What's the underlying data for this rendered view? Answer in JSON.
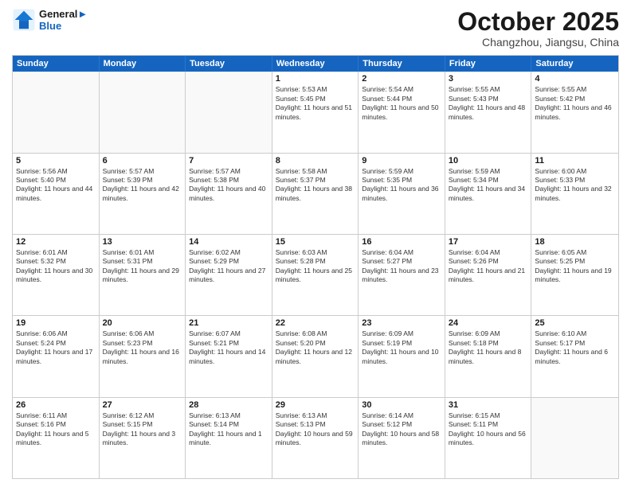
{
  "header": {
    "logo": {
      "line1": "General",
      "line2": "Blue"
    },
    "month": "October 2025",
    "location": "Changzhou, Jiangsu, China"
  },
  "weekdays": [
    "Sunday",
    "Monday",
    "Tuesday",
    "Wednesday",
    "Thursday",
    "Friday",
    "Saturday"
  ],
  "rows": [
    [
      {
        "day": "",
        "empty": true
      },
      {
        "day": "",
        "empty": true
      },
      {
        "day": "",
        "empty": true
      },
      {
        "day": "1",
        "rise": "5:53 AM",
        "set": "5:45 PM",
        "daylight": "11 hours and 51 minutes."
      },
      {
        "day": "2",
        "rise": "5:54 AM",
        "set": "5:44 PM",
        "daylight": "11 hours and 50 minutes."
      },
      {
        "day": "3",
        "rise": "5:55 AM",
        "set": "5:43 PM",
        "daylight": "11 hours and 48 minutes."
      },
      {
        "day": "4",
        "rise": "5:55 AM",
        "set": "5:42 PM",
        "daylight": "11 hours and 46 minutes."
      }
    ],
    [
      {
        "day": "5",
        "rise": "5:56 AM",
        "set": "5:40 PM",
        "daylight": "11 hours and 44 minutes."
      },
      {
        "day": "6",
        "rise": "5:57 AM",
        "set": "5:39 PM",
        "daylight": "11 hours and 42 minutes."
      },
      {
        "day": "7",
        "rise": "5:57 AM",
        "set": "5:38 PM",
        "daylight": "11 hours and 40 minutes."
      },
      {
        "day": "8",
        "rise": "5:58 AM",
        "set": "5:37 PM",
        "daylight": "11 hours and 38 minutes."
      },
      {
        "day": "9",
        "rise": "5:59 AM",
        "set": "5:35 PM",
        "daylight": "11 hours and 36 minutes."
      },
      {
        "day": "10",
        "rise": "5:59 AM",
        "set": "5:34 PM",
        "daylight": "11 hours and 34 minutes."
      },
      {
        "day": "11",
        "rise": "6:00 AM",
        "set": "5:33 PM",
        "daylight": "11 hours and 32 minutes."
      }
    ],
    [
      {
        "day": "12",
        "rise": "6:01 AM",
        "set": "5:32 PM",
        "daylight": "11 hours and 30 minutes."
      },
      {
        "day": "13",
        "rise": "6:01 AM",
        "set": "5:31 PM",
        "daylight": "11 hours and 29 minutes."
      },
      {
        "day": "14",
        "rise": "6:02 AM",
        "set": "5:29 PM",
        "daylight": "11 hours and 27 minutes."
      },
      {
        "day": "15",
        "rise": "6:03 AM",
        "set": "5:28 PM",
        "daylight": "11 hours and 25 minutes."
      },
      {
        "day": "16",
        "rise": "6:04 AM",
        "set": "5:27 PM",
        "daylight": "11 hours and 23 minutes."
      },
      {
        "day": "17",
        "rise": "6:04 AM",
        "set": "5:26 PM",
        "daylight": "11 hours and 21 minutes."
      },
      {
        "day": "18",
        "rise": "6:05 AM",
        "set": "5:25 PM",
        "daylight": "11 hours and 19 minutes."
      }
    ],
    [
      {
        "day": "19",
        "rise": "6:06 AM",
        "set": "5:24 PM",
        "daylight": "11 hours and 17 minutes."
      },
      {
        "day": "20",
        "rise": "6:06 AM",
        "set": "5:23 PM",
        "daylight": "11 hours and 16 minutes."
      },
      {
        "day": "21",
        "rise": "6:07 AM",
        "set": "5:21 PM",
        "daylight": "11 hours and 14 minutes."
      },
      {
        "day": "22",
        "rise": "6:08 AM",
        "set": "5:20 PM",
        "daylight": "11 hours and 12 minutes."
      },
      {
        "day": "23",
        "rise": "6:09 AM",
        "set": "5:19 PM",
        "daylight": "11 hours and 10 minutes."
      },
      {
        "day": "24",
        "rise": "6:09 AM",
        "set": "5:18 PM",
        "daylight": "11 hours and 8 minutes."
      },
      {
        "day": "25",
        "rise": "6:10 AM",
        "set": "5:17 PM",
        "daylight": "11 hours and 6 minutes."
      }
    ],
    [
      {
        "day": "26",
        "rise": "6:11 AM",
        "set": "5:16 PM",
        "daylight": "11 hours and 5 minutes."
      },
      {
        "day": "27",
        "rise": "6:12 AM",
        "set": "5:15 PM",
        "daylight": "11 hours and 3 minutes."
      },
      {
        "day": "28",
        "rise": "6:13 AM",
        "set": "5:14 PM",
        "daylight": "11 hours and 1 minute."
      },
      {
        "day": "29",
        "rise": "6:13 AM",
        "set": "5:13 PM",
        "daylight": "10 hours and 59 minutes."
      },
      {
        "day": "30",
        "rise": "6:14 AM",
        "set": "5:12 PM",
        "daylight": "10 hours and 58 minutes."
      },
      {
        "day": "31",
        "rise": "6:15 AM",
        "set": "5:11 PM",
        "daylight": "10 hours and 56 minutes."
      },
      {
        "day": "",
        "empty": true
      }
    ]
  ],
  "labels": {
    "sunrise": "Sunrise:",
    "sunset": "Sunset:",
    "daylight": "Daylight:"
  }
}
